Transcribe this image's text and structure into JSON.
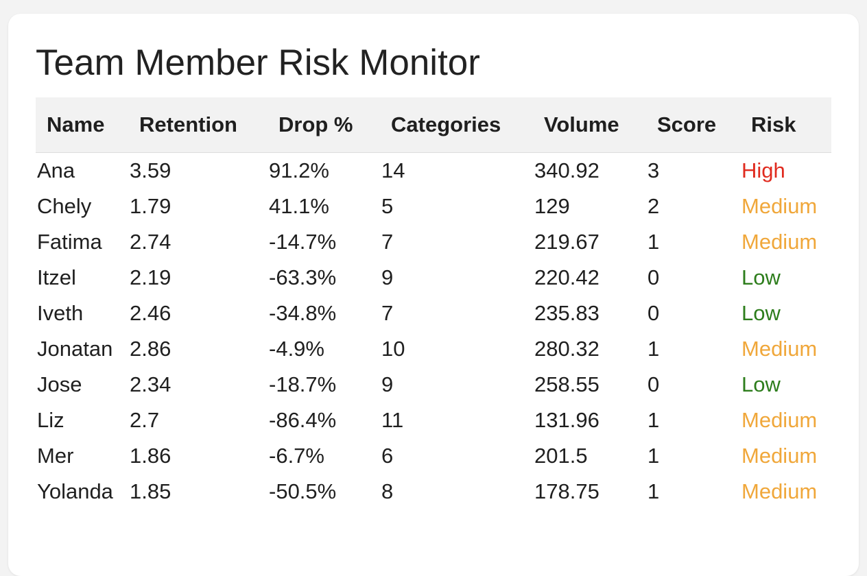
{
  "title": "Team Member Risk Monitor",
  "columns": [
    "Name",
    "Retention",
    "Drop %",
    "Categories",
    "Volume",
    "Score",
    "Risk"
  ],
  "risk_colors": {
    "High": "#e02a1e",
    "Medium": "#f0a73a",
    "Low": "#2d7d1c"
  },
  "rows": [
    {
      "name": "Ana",
      "retention": "3.59",
      "drop": "91.2%",
      "categories": "14",
      "volume": "340.92",
      "score": "3",
      "risk": "High"
    },
    {
      "name": "Chely",
      "retention": "1.79",
      "drop": "41.1%",
      "categories": "5",
      "volume": "129",
      "score": "2",
      "risk": "Medium"
    },
    {
      "name": "Fatima",
      "retention": "2.74",
      "drop": "-14.7%",
      "categories": "7",
      "volume": "219.67",
      "score": "1",
      "risk": "Medium"
    },
    {
      "name": "Itzel",
      "retention": "2.19",
      "drop": "-63.3%",
      "categories": "9",
      "volume": "220.42",
      "score": "0",
      "risk": "Low"
    },
    {
      "name": "Iveth",
      "retention": "2.46",
      "drop": "-34.8%",
      "categories": "7",
      "volume": "235.83",
      "score": "0",
      "risk": "Low"
    },
    {
      "name": "Jonatan",
      "retention": "2.86",
      "drop": "-4.9%",
      "categories": "10",
      "volume": "280.32",
      "score": "1",
      "risk": "Medium"
    },
    {
      "name": "Jose",
      "retention": "2.34",
      "drop": "-18.7%",
      "categories": "9",
      "volume": "258.55",
      "score": "0",
      "risk": "Low"
    },
    {
      "name": "Liz",
      "retention": "2.7",
      "drop": "-86.4%",
      "categories": "11",
      "volume": "131.96",
      "score": "1",
      "risk": "Medium"
    },
    {
      "name": "Mer",
      "retention": "1.86",
      "drop": "-6.7%",
      "categories": "6",
      "volume": "201.5",
      "score": "1",
      "risk": "Medium"
    },
    {
      "name": "Yolanda",
      "retention": "1.85",
      "drop": "-50.5%",
      "categories": "8",
      "volume": "178.75",
      "score": "1",
      "risk": "Medium"
    }
  ]
}
